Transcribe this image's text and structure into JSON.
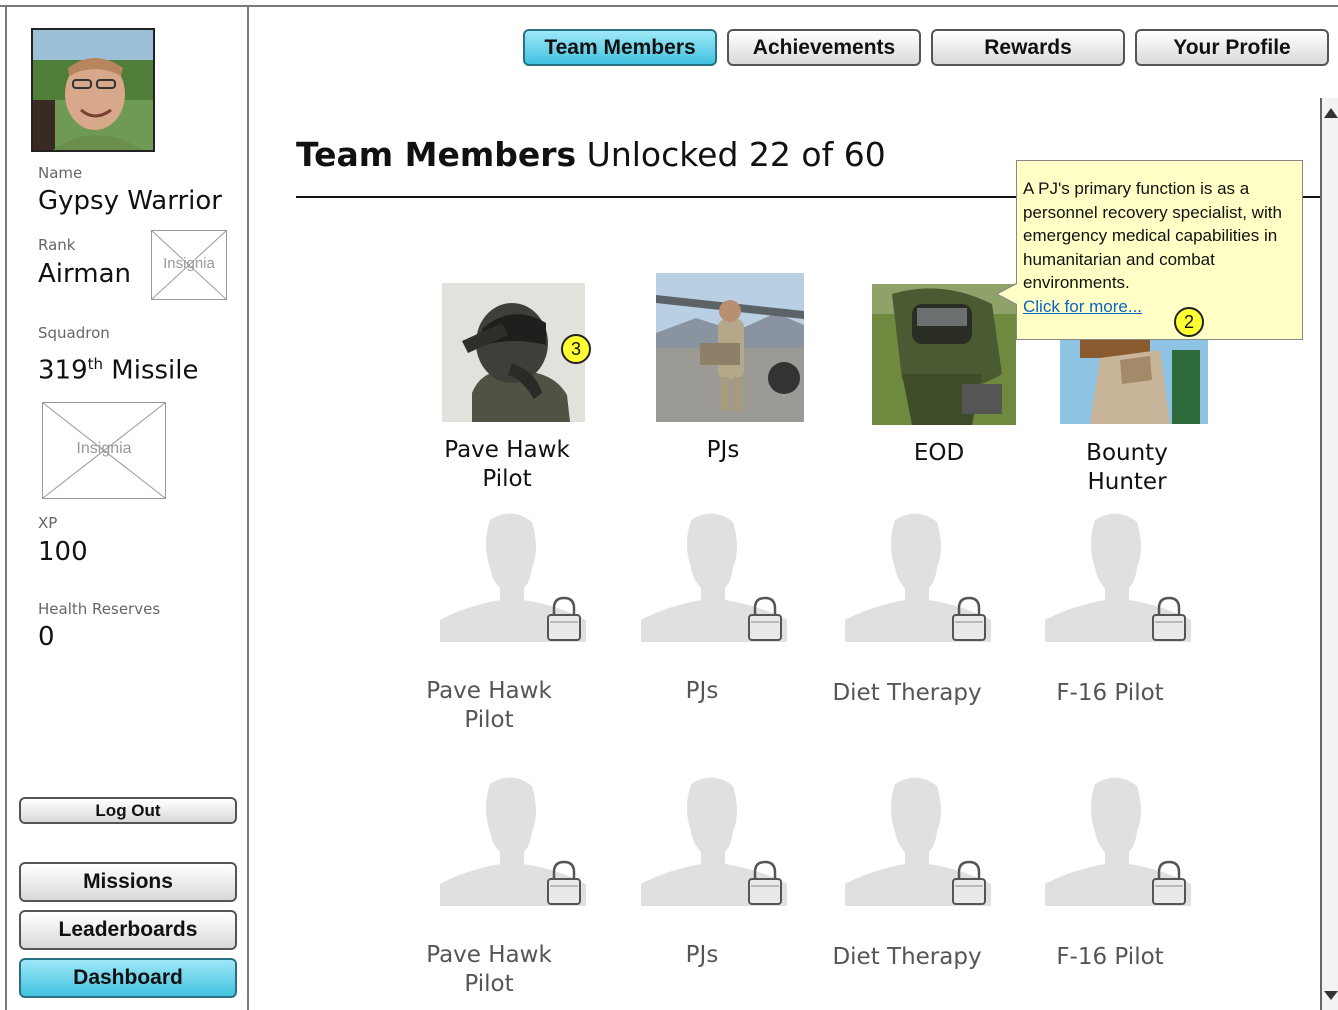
{
  "profile": {
    "name_label": "Name",
    "name": "Gypsy Warrior",
    "rank_label": "Rank",
    "rank": "Airman",
    "rank_insignia": "Insignia",
    "squadron_label": "Squadron",
    "squadron_number": "319",
    "squadron_suffix": "th",
    "squadron_name": " Missile",
    "squadron_insignia": "Insignia",
    "xp_label": "XP",
    "xp": "100",
    "health_label": "Health Reserves",
    "health": "0"
  },
  "sidebar": {
    "logout": "Log Out",
    "nav": [
      {
        "label": "Missions",
        "active": false
      },
      {
        "label": "Leaderboards",
        "active": false
      },
      {
        "label": "Dashboard",
        "active": true
      }
    ]
  },
  "tabs": [
    {
      "label": "Team Members",
      "active": true
    },
    {
      "label": "Achievements",
      "active": false
    },
    {
      "label": "Rewards",
      "active": false
    },
    {
      "label": "Your Profile",
      "active": false
    }
  ],
  "page": {
    "title_bold": "Team Members",
    "title_rest": " Unlocked 22 of 60"
  },
  "unlocked": [
    {
      "label_line1": "Pave Hawk",
      "label_line2": "Pilot",
      "image": "pilot-salute"
    },
    {
      "label_line1": "PJs",
      "label_line2": "",
      "image": "pj-airfield"
    },
    {
      "label_line1": "EOD",
      "label_line2": "",
      "image": "eod-bomb-suit"
    },
    {
      "label_line1": "Bounty",
      "label_line2": "Hunter",
      "image": "bounty-hunter"
    }
  ],
  "locked_rows": [
    [
      {
        "label_line1": "Pave Hawk",
        "label_line2": "Pilot"
      },
      {
        "label_line1": "PJs",
        "label_line2": ""
      },
      {
        "label_line1": "Diet Therapy",
        "label_line2": ""
      },
      {
        "label_line1": "F-16 Pilot",
        "label_line2": ""
      }
    ],
    [
      {
        "label_line1": "Pave Hawk",
        "label_line2": "Pilot"
      },
      {
        "label_line1": "PJs",
        "label_line2": ""
      },
      {
        "label_line1": "Diet Therapy",
        "label_line2": ""
      },
      {
        "label_line1": "F-16 Pilot",
        "label_line2": ""
      }
    ]
  ],
  "tooltip": {
    "text": "A PJ's primary function is as a personnel recovery specialist, with emergency medical capabilities in humanitarian and combat environments.",
    "link": "Click for more...",
    "badge": "2"
  },
  "annotation_badge": "3",
  "colors": {
    "active_button": "#41c2e0",
    "tooltip_bg": "#ffffc6",
    "badge": "#ffff33",
    "locked_silhouette": "#e0e0e0"
  }
}
